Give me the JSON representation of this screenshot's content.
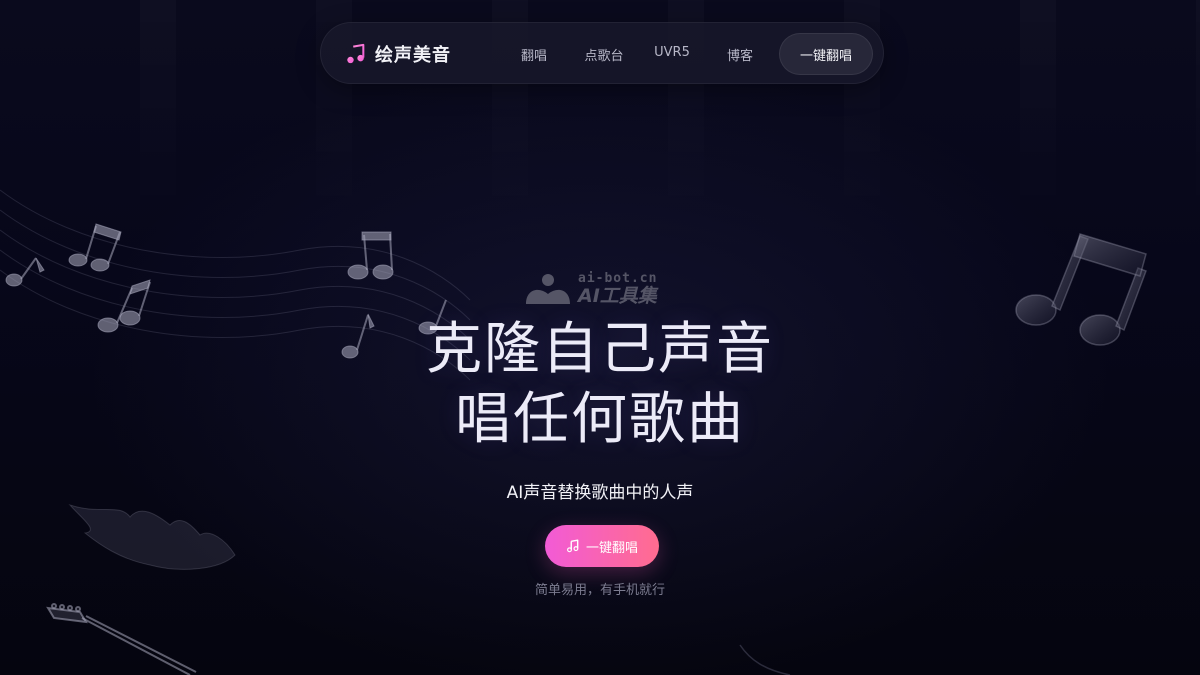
{
  "brand": {
    "name": "绘声美音",
    "icon": "music-note-icon",
    "accent_gradient": [
      "#f25bd6",
      "#ff6c8f"
    ]
  },
  "nav": {
    "links": [
      "翻唱",
      "点歌台",
      "UVR5",
      "博客"
    ],
    "cta_label": "一键翻唱"
  },
  "watermark": {
    "top": "ai-bot.cn",
    "bottom": "AI工具集"
  },
  "hero": {
    "title_line1": "克隆自己声音",
    "title_line2": "唱任何歌曲",
    "subtitle": "AI声音替换歌曲中的人声",
    "cta_label": "一键翻唱",
    "cta_icon": "music-note-icon",
    "note": "简单易用，有手机就行"
  },
  "colors": {
    "background": "#07071a",
    "title": "#ecebf8",
    "muted": "#7c7c90"
  }
}
